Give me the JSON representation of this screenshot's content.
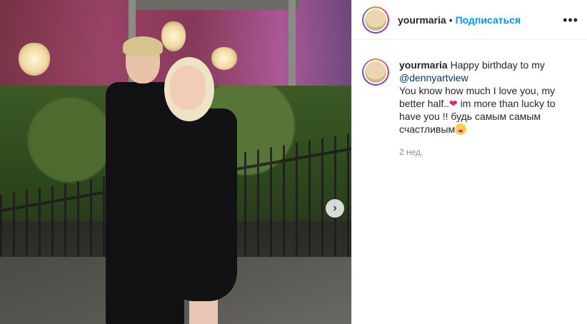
{
  "post": {
    "next_icon": "chevron-right",
    "next_glyph": "›"
  },
  "header": {
    "username": "yourmaria",
    "separator": "•",
    "follow_label": "Подписаться",
    "more_glyph": "•••"
  },
  "caption": {
    "username": "yourmaria",
    "text_1": "Happy birthday to my",
    "mention": "@dennyartview",
    "text_2": "You know how much I love you, my better half..",
    "heart": "❤",
    "text_3": " im more than lucky to have you !! будь самым самым счастливым",
    "timestamp": "2 нед."
  },
  "colors": {
    "accent": "#0095f6",
    "mention": "#00376b",
    "muted": "#8e8e8e"
  }
}
